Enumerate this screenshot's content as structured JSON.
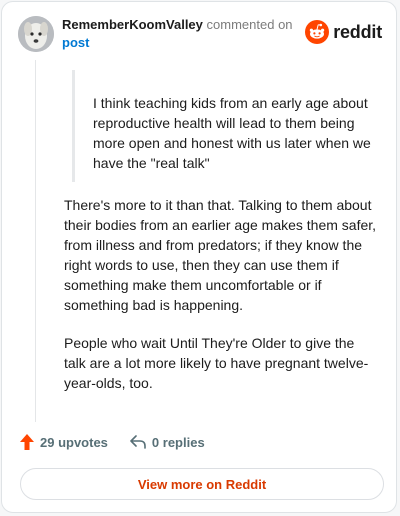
{
  "comment": {
    "username": "RememberKoomValley",
    "commented_on": "commented on",
    "post_link": "post",
    "quote": "I think teaching kids from an early age about reproductive health will lead to them being more open and honest with us later when we have the \"real talk\"",
    "paragraphs": [
      "There's more to it than that. Talking to them about their bodies from an earlier age makes them safer, from illness and from predators; if they know the right words to use, then they can use them if something make them uncomfortable or if something bad is happening.",
      "People who wait Until They're Older to give the talk are a lot more likely to have pregnant twelve-year-olds, too."
    ]
  },
  "brand": {
    "name": "reddit",
    "icon": "reddit-snoo-icon",
    "color": "#ff4500"
  },
  "actions": {
    "upvotes": "29 upvotes",
    "replies": "0 replies",
    "upvote_icon": "upvote-arrow-icon",
    "reply_icon": "reply-arrow-icon"
  },
  "footer": {
    "view_more": "View more on Reddit"
  },
  "colors": {
    "accent": "#d93a00",
    "link": "#0079d3",
    "upvote": "#ff4500",
    "action_text": "#576f76"
  }
}
